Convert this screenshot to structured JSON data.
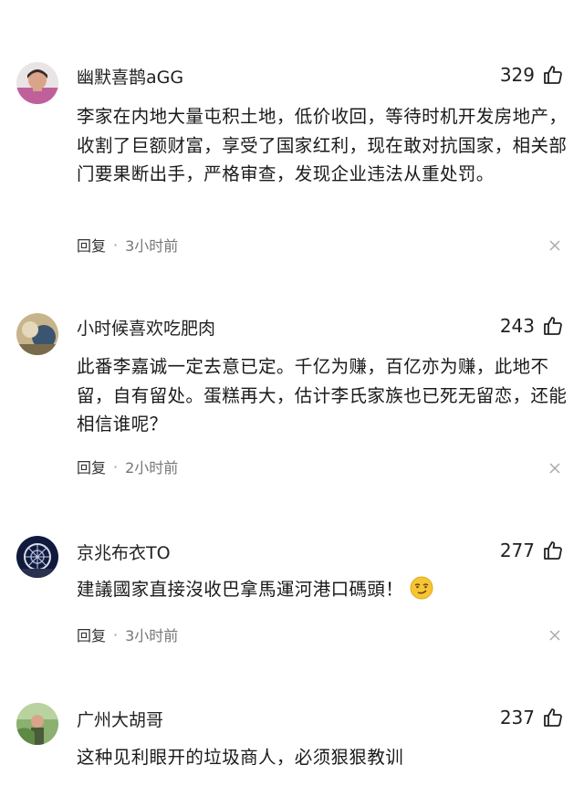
{
  "comments": [
    {
      "username": "幽默喜鹊aGG",
      "likes": "329",
      "text": "李家在内地大量屯积土地，低价收回，等待时机开发房地产，收割了巨额财富，享受了国家红利，现在敢对抗国家，相关部门要果断出手，严格审查，发现企业违法从重处罚。",
      "reply_label": "回复",
      "separator": "·",
      "time": "3小时前"
    },
    {
      "username": "小时候喜欢吃肥肉",
      "likes": "243",
      "text": "此番李嘉诚一定去意已定。千亿为赚，百亿亦为赚，此地不留，自有留处。蛋糕再大，估计李氏家族也已死无留恋，还能相信谁呢？",
      "reply_label": "回复",
      "separator": "·",
      "time": "2小时前"
    },
    {
      "username": "京兆布衣TO",
      "likes": "277",
      "text": "建議國家直接沒收巴拿馬運河港口碼頭！",
      "emoji": "smirk-emoji",
      "reply_label": "回复",
      "separator": "·",
      "time": "3小时前"
    },
    {
      "username": "广州大胡哥",
      "likes": "237",
      "text": "这种见利眼开的垃圾商人，必须狠狠教训"
    }
  ],
  "colors": {
    "text": "#1a1a1a",
    "meta": "#777777",
    "background": "#ffffff"
  }
}
